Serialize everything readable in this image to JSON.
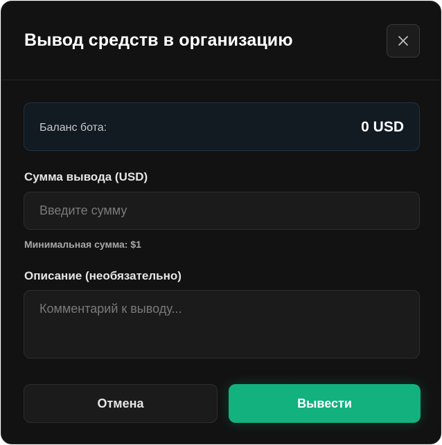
{
  "modal": {
    "title": "Вывод средств в организацию"
  },
  "balance": {
    "label": "Баланс бота:",
    "value": "0 USD"
  },
  "amount": {
    "label": "Сумма вывода (USD)",
    "placeholder": "Введите сумму",
    "value": "",
    "hint": "Минимальная сумма: $1"
  },
  "description": {
    "label": "Описание (необязательно)",
    "placeholder": "Комментарий к выводу...",
    "value": ""
  },
  "actions": {
    "cancel_label": "Отмена",
    "submit_label": "Вывести"
  },
  "colors": {
    "accent": "#13b17e",
    "background": "#121212",
    "balance_bg": "#121a22"
  },
  "icons": {
    "close": "close-icon"
  }
}
